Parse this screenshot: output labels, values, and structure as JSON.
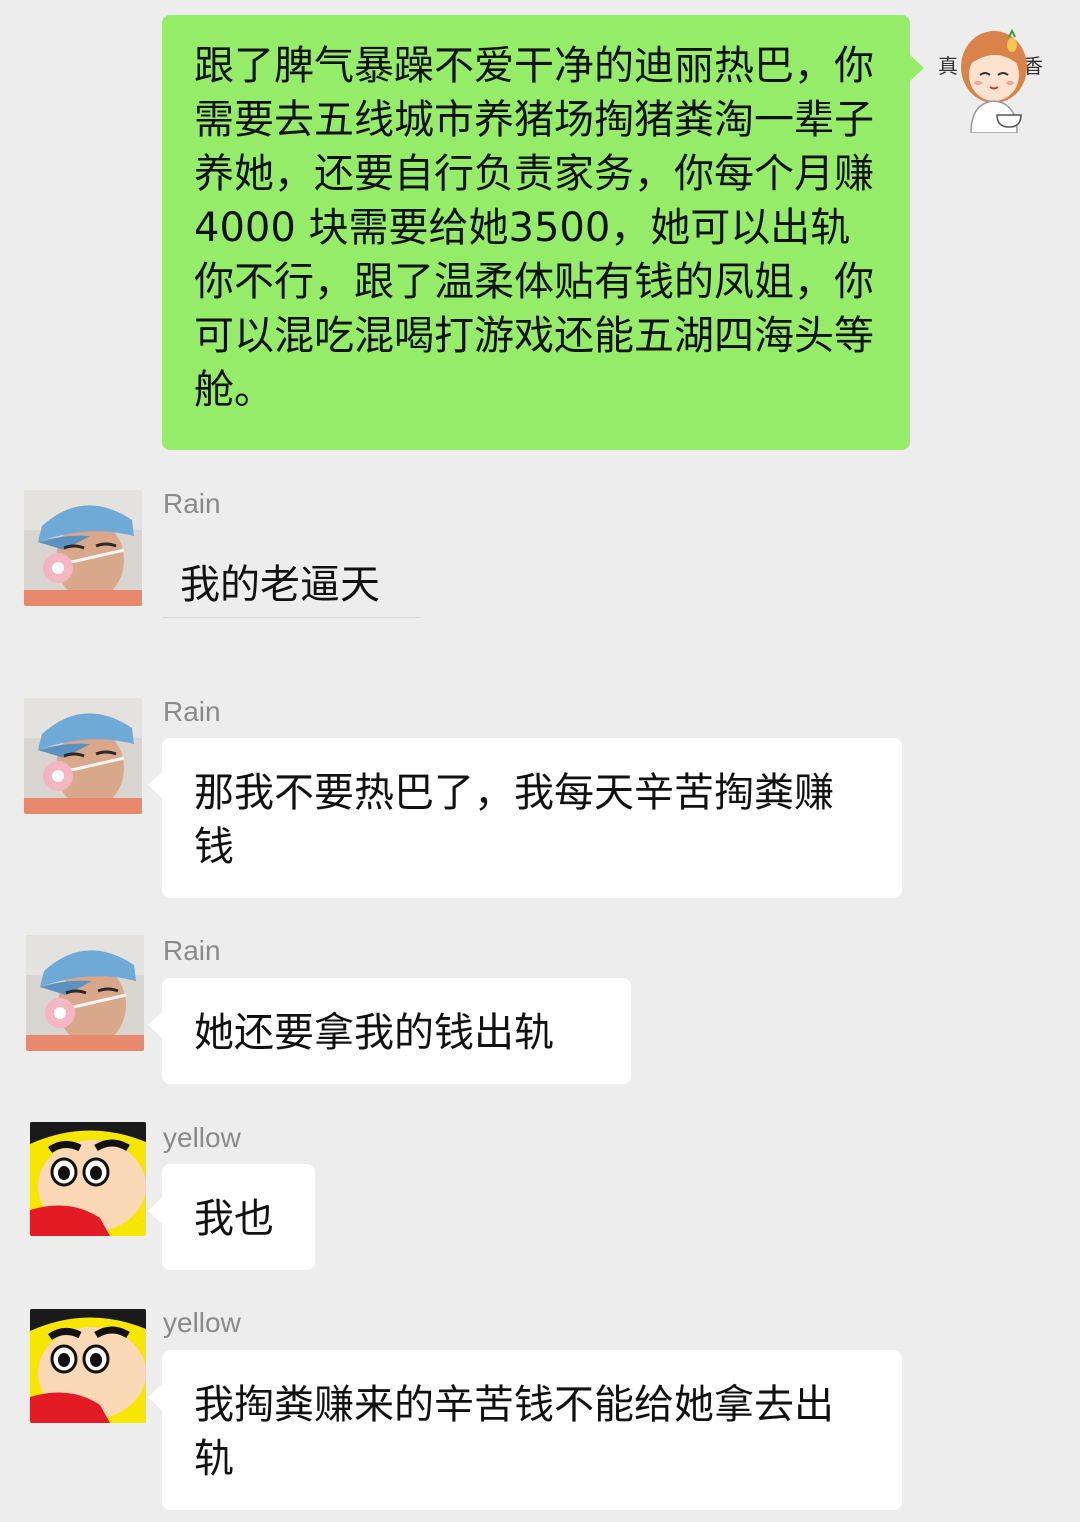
{
  "colors": {
    "background": "#ededed",
    "outgoing_bubble": "#95ec69",
    "incoming_bubble": "#ffffff",
    "sender_name": "#8a8a8a"
  },
  "outgoing": {
    "text": "跟了脾气暴躁不爱干净的迪丽热巴，你需要去五线城市养猪场掏猪粪淘一辈子养她，还要自行负责家务，你每个月赚 4000 块需要给她3500，她可以出轨你不行，跟了温柔体贴有钱的凤姐，你可以混吃混喝打游戏还能五湖四海头等舱。",
    "avatar": {
      "icon": "cartoon-girl-avatar",
      "side_text_left": "真",
      "side_text_right": "香"
    }
  },
  "messages": [
    {
      "sender": "Rain",
      "avatar": "cap-boy-avatar",
      "text": "我的老逼天"
    },
    {
      "sender": "Rain",
      "avatar": "cap-boy-avatar",
      "text": "那我不要热巴了，我每天辛苦掏粪赚钱"
    },
    {
      "sender": "Rain",
      "avatar": "cap-boy-avatar",
      "text": "她还要拿我的钱出轨"
    },
    {
      "sender": "yellow",
      "avatar": "crayon-shinchan-avatar",
      "text": "我也"
    },
    {
      "sender": "yellow",
      "avatar": "crayon-shinchan-avatar",
      "text": "我掏粪赚来的辛苦钱不能给她拿去出轨"
    }
  ]
}
